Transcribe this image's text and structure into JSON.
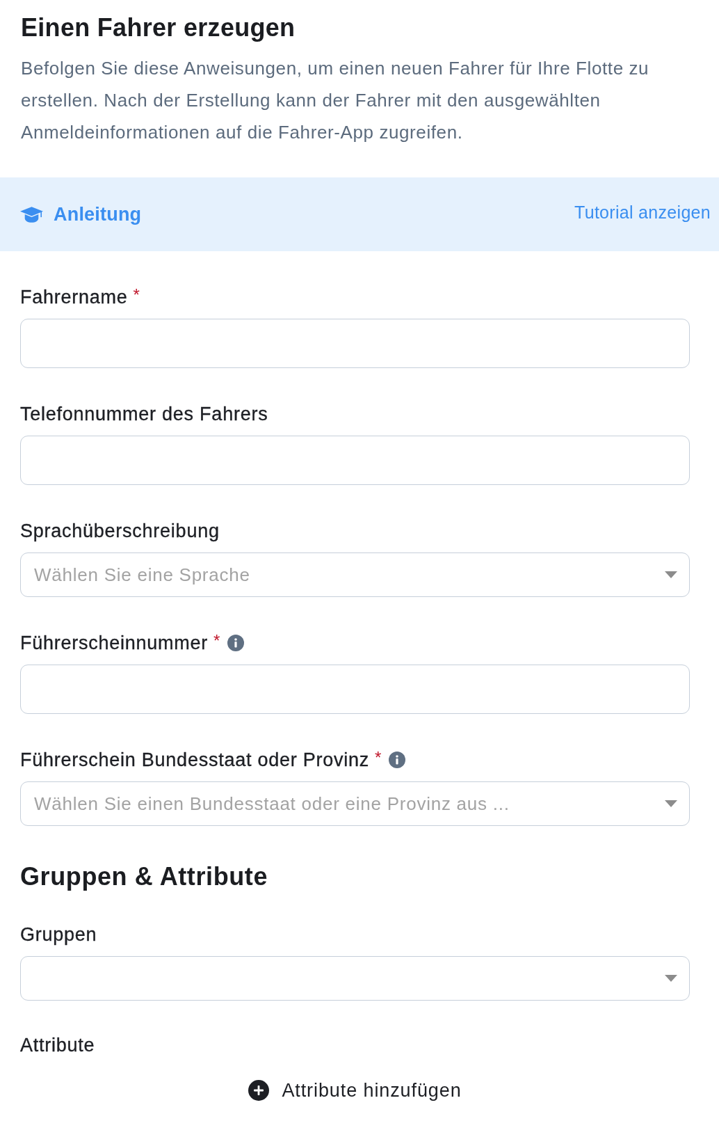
{
  "header": {
    "title": "Einen Fahrer erzeugen",
    "description": "Befolgen Sie diese Anweisungen, um einen neuen Fahrer für Ihre Flotte zu erstellen. Nach der Erstellung kann der Fahrer mit den ausgewählten Anmeldeinformationen auf die Fahrer-App zugreifen."
  },
  "guide_bar": {
    "title": "Anleitung",
    "link": "Tutorial anzeigen"
  },
  "fields": [
    {
      "kind": "input",
      "label": "Fahrername",
      "required_mark": "*",
      "info": false
    },
    {
      "kind": "input",
      "label": "Telefonnummer des Fahrers",
      "info": false
    },
    {
      "kind": "select",
      "label": "Sprachüberschreibung",
      "placeholder": "Wählen Sie eine Sprache",
      "info": false
    },
    {
      "kind": "input",
      "label": "Führerscheinnummer",
      "required_mark": "*",
      "info": true
    },
    {
      "kind": "select",
      "label": "Führerschein Bundesstaat oder Provinz",
      "required_mark": "*",
      "info": true,
      "placeholder": "Wählen Sie einen Bundesstaat oder eine Provinz aus ..."
    }
  ],
  "groups_section": {
    "title": "Gruppen & Attribute",
    "fields": [
      {
        "kind": "select",
        "label": "Gruppen",
        "info": false
      }
    ],
    "attributes": {
      "label": "Attribute",
      "add_button": "Attribute hinzufügen"
    }
  }
}
